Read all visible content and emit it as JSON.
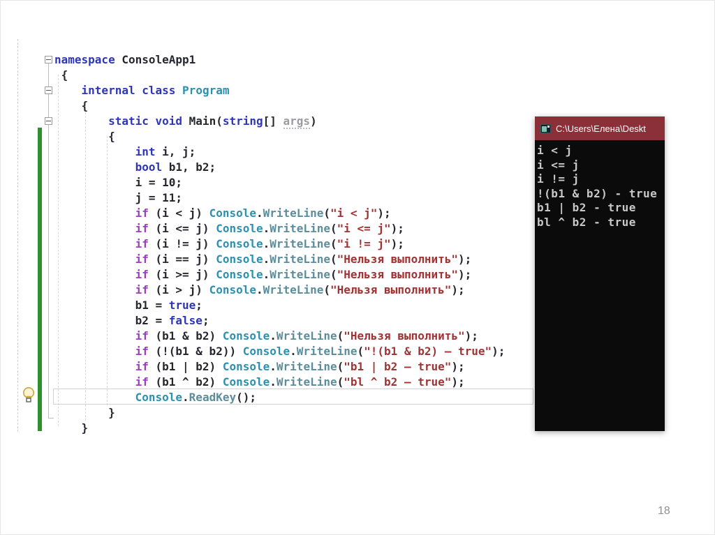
{
  "slide": {
    "page_number": "18"
  },
  "editor": {
    "code_lines": [
      {
        "collapse": true,
        "tokens": [
          [
            "kw",
            "namespace"
          ],
          [
            "plain",
            " ConsoleApp1"
          ]
        ]
      },
      {
        "collapse": false,
        "tokens": [
          [
            "plain",
            " {"
          ]
        ]
      },
      {
        "collapse": true,
        "tokens": [
          [
            "plain",
            "    "
          ],
          [
            "kw",
            "internal"
          ],
          [
            "plain",
            " "
          ],
          [
            "kw",
            "class"
          ],
          [
            "plain",
            " "
          ],
          [
            "type",
            "Program"
          ]
        ]
      },
      {
        "collapse": false,
        "tokens": [
          [
            "plain",
            "    {"
          ]
        ]
      },
      {
        "collapse": true,
        "tokens": [
          [
            "plain",
            "        "
          ],
          [
            "kw",
            "static"
          ],
          [
            "plain",
            " "
          ],
          [
            "kw",
            "void"
          ],
          [
            "plain",
            " Main("
          ],
          [
            "kw",
            "string"
          ],
          [
            "plain",
            "[] "
          ],
          [
            "param",
            "args"
          ],
          [
            "plain",
            ")"
          ]
        ]
      },
      {
        "collapse": false,
        "tokens": [
          [
            "plain",
            "        {"
          ]
        ]
      },
      {
        "collapse": false,
        "tokens": [
          [
            "plain",
            "            "
          ],
          [
            "kw",
            "int"
          ],
          [
            "plain",
            " i, j;"
          ]
        ]
      },
      {
        "collapse": false,
        "tokens": [
          [
            "plain",
            "            "
          ],
          [
            "kw",
            "bool"
          ],
          [
            "plain",
            " b1, b2;"
          ]
        ]
      },
      {
        "collapse": false,
        "tokens": [
          [
            "plain",
            "            i = 10;"
          ]
        ]
      },
      {
        "collapse": false,
        "tokens": [
          [
            "plain",
            "            j = 11;"
          ]
        ]
      },
      {
        "collapse": false,
        "tokens": [
          [
            "plain",
            "            "
          ],
          [
            "ctrl",
            "if"
          ],
          [
            "plain",
            " (i < j) "
          ],
          [
            "type",
            "Console"
          ],
          [
            "plain",
            "."
          ],
          [
            "method",
            "WriteLine"
          ],
          [
            "plain",
            "("
          ],
          [
            "str",
            "\"i < j\""
          ],
          [
            "plain",
            ");"
          ]
        ]
      },
      {
        "collapse": false,
        "tokens": [
          [
            "plain",
            "            "
          ],
          [
            "ctrl",
            "if"
          ],
          [
            "plain",
            " (i <= j) "
          ],
          [
            "type",
            "Console"
          ],
          [
            "plain",
            "."
          ],
          [
            "method",
            "WriteLine"
          ],
          [
            "plain",
            "("
          ],
          [
            "str",
            "\"i <= j\""
          ],
          [
            "plain",
            ");"
          ]
        ]
      },
      {
        "collapse": false,
        "tokens": [
          [
            "plain",
            "            "
          ],
          [
            "ctrl",
            "if"
          ],
          [
            "plain",
            " (i != j) "
          ],
          [
            "type",
            "Console"
          ],
          [
            "plain",
            "."
          ],
          [
            "method",
            "WriteLine"
          ],
          [
            "plain",
            "("
          ],
          [
            "str",
            "\"i != j\""
          ],
          [
            "plain",
            ");"
          ]
        ]
      },
      {
        "collapse": false,
        "tokens": [
          [
            "plain",
            "            "
          ],
          [
            "ctrl",
            "if"
          ],
          [
            "plain",
            " (i == j) "
          ],
          [
            "type",
            "Console"
          ],
          [
            "plain",
            "."
          ],
          [
            "method",
            "WriteLine"
          ],
          [
            "plain",
            "("
          ],
          [
            "str",
            "\"Нельзя выполнить\""
          ],
          [
            "plain",
            ");"
          ]
        ]
      },
      {
        "collapse": false,
        "tokens": [
          [
            "plain",
            "            "
          ],
          [
            "ctrl",
            "if"
          ],
          [
            "plain",
            " (i >= j) "
          ],
          [
            "type",
            "Console"
          ],
          [
            "plain",
            "."
          ],
          [
            "method",
            "WriteLine"
          ],
          [
            "plain",
            "("
          ],
          [
            "str",
            "\"Нельзя выполнить\""
          ],
          [
            "plain",
            ");"
          ]
        ]
      },
      {
        "collapse": false,
        "tokens": [
          [
            "plain",
            "            "
          ],
          [
            "ctrl",
            "if"
          ],
          [
            "plain",
            " (i > j) "
          ],
          [
            "type",
            "Console"
          ],
          [
            "plain",
            "."
          ],
          [
            "method",
            "WriteLine"
          ],
          [
            "plain",
            "("
          ],
          [
            "str",
            "\"Нельзя выполнить\""
          ],
          [
            "plain",
            ");"
          ]
        ]
      },
      {
        "collapse": false,
        "tokens": [
          [
            "plain",
            "            b1 = "
          ],
          [
            "kw",
            "true"
          ],
          [
            "plain",
            ";"
          ]
        ]
      },
      {
        "collapse": false,
        "tokens": [
          [
            "plain",
            "            b2 = "
          ],
          [
            "kw",
            "false"
          ],
          [
            "plain",
            ";"
          ]
        ]
      },
      {
        "collapse": false,
        "tokens": [
          [
            "plain",
            "            "
          ],
          [
            "ctrl",
            "if"
          ],
          [
            "plain",
            " (b1 & b2) "
          ],
          [
            "type",
            "Console"
          ],
          [
            "plain",
            "."
          ],
          [
            "method",
            "WriteLine"
          ],
          [
            "plain",
            "("
          ],
          [
            "str",
            "\"Нельзя выполнить\""
          ],
          [
            "plain",
            ");"
          ]
        ]
      },
      {
        "collapse": false,
        "tokens": [
          [
            "plain",
            "            "
          ],
          [
            "ctrl",
            "if"
          ],
          [
            "plain",
            " (!(b1 & b2)) "
          ],
          [
            "type",
            "Console"
          ],
          [
            "plain",
            "."
          ],
          [
            "method",
            "WriteLine"
          ],
          [
            "plain",
            "("
          ],
          [
            "str",
            "\"!(b1 & b2) – true\""
          ],
          [
            "plain",
            ");"
          ]
        ]
      },
      {
        "collapse": false,
        "tokens": [
          [
            "plain",
            "            "
          ],
          [
            "ctrl",
            "if"
          ],
          [
            "plain",
            " (b1 | b2) "
          ],
          [
            "type",
            "Console"
          ],
          [
            "plain",
            "."
          ],
          [
            "method",
            "WriteLine"
          ],
          [
            "plain",
            "("
          ],
          [
            "str",
            "\"b1 | b2 – true\""
          ],
          [
            "plain",
            ");"
          ]
        ]
      },
      {
        "collapse": false,
        "tokens": [
          [
            "plain",
            "            "
          ],
          [
            "ctrl",
            "if"
          ],
          [
            "plain",
            " (b1 ^ b2) "
          ],
          [
            "type",
            "Console"
          ],
          [
            "plain",
            "."
          ],
          [
            "method",
            "WriteLine"
          ],
          [
            "plain",
            "("
          ],
          [
            "str",
            "\"bl ^ b2 – true\""
          ],
          [
            "plain",
            ");"
          ]
        ]
      },
      {
        "collapse": false,
        "tokens": [
          [
            "plain",
            "            "
          ],
          [
            "type",
            "Console"
          ],
          [
            "plain",
            "."
          ],
          [
            "method",
            "ReadKey"
          ],
          [
            "plain",
            "();"
          ]
        ]
      },
      {
        "collapse": false,
        "tokens": [
          [
            "plain",
            "        }"
          ]
        ]
      },
      {
        "collapse": false,
        "tokens": [
          [
            "plain",
            "    }"
          ]
        ]
      }
    ]
  },
  "console_window": {
    "title": "C:\\Users\\Елена\\Deskt",
    "lines": [
      "i < j",
      "i <= j",
      "i != j",
      "!(b1 & b2) - true",
      "b1 | b2 - true",
      "bl ^ b2 - true"
    ]
  },
  "colors": {
    "console_titlebar": "#8b3038",
    "console_background": "#0b0b0b",
    "console_text": "#c8c8c8",
    "change_bar_green": "#2f8f2f",
    "keyword_blue": "#2d35bd",
    "control_keyword_purple": "#9b3fc0",
    "type_teal": "#2b91af",
    "string_red": "#a03434"
  }
}
